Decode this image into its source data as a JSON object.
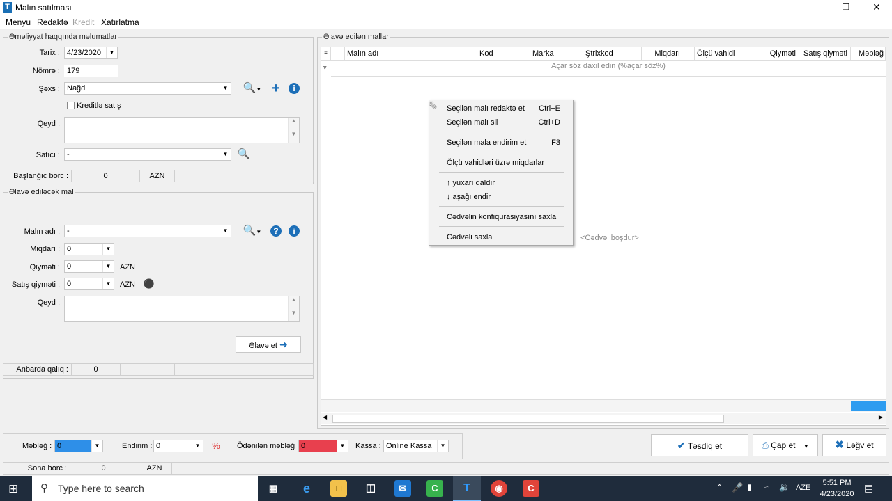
{
  "window": {
    "title": "Malın satılması",
    "app_icon": "T"
  },
  "menu": [
    "Menyu",
    "Redaktə",
    "Kredit",
    "Xatırlatma"
  ],
  "operation": {
    "group_title": "Əməliyyat haqqında məlumatlar",
    "date_label": "Tarix :",
    "date_value": "4/23/2020",
    "number_label": "Nömrə :",
    "number_value": "179",
    "person_label": "Şəxs :",
    "person_value": "Nağd",
    "credit_label": "Kreditlə satış",
    "note_label": "Qeyd :",
    "seller_label": "Satıcı :",
    "seller_value": "-",
    "start_debt_label": "Başlanğıc borc :",
    "start_debt_value": "0",
    "start_debt_currency": "AZN"
  },
  "goods_to_add": {
    "group_title": "Əlavə ediləcək mal",
    "name_label": "Malın adı :",
    "name_value": "-",
    "qty_label": "Miqdarı :",
    "qty_value": "0",
    "price_label": "Qiyməti :",
    "price_value": "0",
    "price_currency": "AZN",
    "sale_price_label": "Satış qiyməti :",
    "sale_price_value": "0",
    "sale_price_currency": "AZN",
    "note_label": "Qeyd :",
    "add_button": "Əlavə et",
    "stock_label": "Anbarda qalıq :",
    "stock_value": "0"
  },
  "added_goods": {
    "group_title": "Əlavə edilən mallar",
    "columns": [
      "Malın adı",
      "Kod",
      "Marka",
      "Ştrixkod",
      "Miqdarı",
      "Ölçü vahidi",
      "Qiyməti",
      "Satış qiyməti",
      "Məbləğ"
    ],
    "filter_placeholder": "Açar söz daxil edin (%açar söz%)",
    "empty_text": "<Cədvəl boşdur>"
  },
  "context_menu": {
    "items": [
      {
        "label": "Seçilən malı redaktə et",
        "shortcut": "Ctrl+E"
      },
      {
        "label": "Seçilən malı sil",
        "shortcut": "Ctrl+D"
      },
      {
        "label": "Seçilən mala endirim et",
        "shortcut": "F3"
      },
      {
        "label": "Ölçü vahidləri üzrə miqdarlar",
        "shortcut": ""
      },
      {
        "label": "↑ yuxarı qaldır",
        "shortcut": ""
      },
      {
        "label": "↓ aşağı endir",
        "shortcut": ""
      },
      {
        "label": "Cədvəlin konfiqurasiyasını saxla",
        "shortcut": ""
      },
      {
        "label": "Cədvəli saxla",
        "shortcut": ""
      }
    ]
  },
  "bottom": {
    "amount_label": "Məbləğ :",
    "amount_value": "0",
    "discount_label": "Endirim :",
    "discount_value": "0",
    "paid_label": "Ödənilən məbləğ :",
    "paid_value": "0",
    "cash_label": "Kassa :",
    "cash_value": "Online Kassa",
    "confirm_button": "Təsdiq et",
    "print_button": "Çap et",
    "cancel_button": "Ləğv et",
    "final_debt_label": "Sona borc :",
    "final_debt_value": "0",
    "final_debt_currency": "AZN"
  },
  "colors": {
    "amount_bg": "#2e8fe8",
    "paid_bg": "#e8404e",
    "accent": "#1d6fb8",
    "taskbar": "#1f2c3c"
  },
  "taskbar": {
    "search_placeholder": "Type here to search",
    "language": "AZE",
    "time": "5:51 PM",
    "date": "4/23/2020"
  }
}
